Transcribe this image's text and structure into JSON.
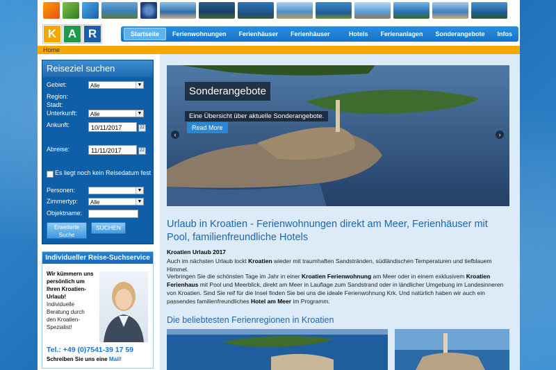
{
  "logo": {
    "letters": [
      "K",
      "A",
      "R"
    ],
    "colors": [
      "#f7a600",
      "#1f9a4a",
      "#1a5fa8"
    ]
  },
  "nav": {
    "items": [
      {
        "label": "Startseite",
        "active": true
      },
      {
        "label": "Ferienwohnungen",
        "active": false
      },
      {
        "label": "Ferienhäuser",
        "active": false
      },
      {
        "label": "Ferienhäuser mit Pool",
        "active": false
      },
      {
        "label": "Hotels",
        "active": false
      },
      {
        "label": "Ferienanlagen",
        "active": false
      },
      {
        "label": "Sonderangebote",
        "active": false
      },
      {
        "label": "Infos",
        "active": false
      }
    ]
  },
  "breadcrumb": {
    "home": "Home"
  },
  "search": {
    "title": "Reiseziel suchen",
    "gebiet_label": "Gebiet:",
    "gebiet_value": "Alle",
    "region_label": "Region:",
    "stadt_label": "Stadt:",
    "unterkunft_label": "Unterkunft:",
    "unterkunft_value": "Alle",
    "anreise_label": "Ankunft:",
    "anreise_value": "10/11/2017",
    "abreise_label": "Abreise:",
    "abreise_value": "11/11/2017",
    "nodate_label": "Es liegt noch kein Reisedatum fest",
    "personen_label": "Personen:",
    "personen_value": "",
    "zimmertyp_label": "Zimmertyp:",
    "zimmertyp_value": "Alle",
    "objektname_label": "Objektname:",
    "erweiterte_label_1": "Erweiterte",
    "erweiterte_label_2": "Suche",
    "submit_label": "SUCHEN",
    "calendar_day": "22"
  },
  "service": {
    "title": "Individueller Reise-Suchservice",
    "bold_lines": [
      "Wir kümmern uns",
      "persönlich um",
      "Ihren Kroatien-",
      "Urlaub!"
    ],
    "lines": [
      "Individuelle",
      "Beratung durch",
      "den Kroatien-",
      "Spezialist!"
    ],
    "phone": "Tel.: +49 (0)7541-39 17 59",
    "mail_prefix": "Schreiben Sie uns eine",
    "mail_link": "Mail!"
  },
  "hero": {
    "title": "Sonderangebote",
    "subtitle": "Eine Übersicht über aktuelle Sonderangebote.",
    "button": "Read More",
    "prev": "‹",
    "next": "›"
  },
  "content": {
    "title": "Urlaub in Kroatien - Ferienwohnungen direkt am Meer, Ferienhäuser mit Pool, familienfreundliche Hotels",
    "intro_heading": "Kroatien Urlaub 2017",
    "p1_a": "Auch im nächsten Urlaub lockt ",
    "p1_b": "Kroatien",
    "p1_c": " wieder mit traumhaften Sandstränden, südländischen Temperaturen und tiefblauem Himmel.",
    "p2_a": "Verbringen Sie die schönsten Tage im Jahr in einer ",
    "p2_b": "Kroatien Ferienwohnung",
    "p2_c": " am Meer oder in einem exklusivem ",
    "p2_d": "Kroatien Ferienhaus",
    "p2_e": " mit Pool und Meerblick, direkt am Meer in Lauflage zum Sandstrand oder in ländlicher Umgebung im Landesinneren von Kroatien. Sind Sie reif für die Insel finden Sie bei uns die ideale Ferienwohnung Krk. Und natürlich haben wir auch ein passendes familienfreundliches ",
    "p2_f": "Hotel am Meer",
    "p2_g": " im Programm.",
    "regions_title": "Die beliebtesten Ferienregionen in Kroatien"
  }
}
